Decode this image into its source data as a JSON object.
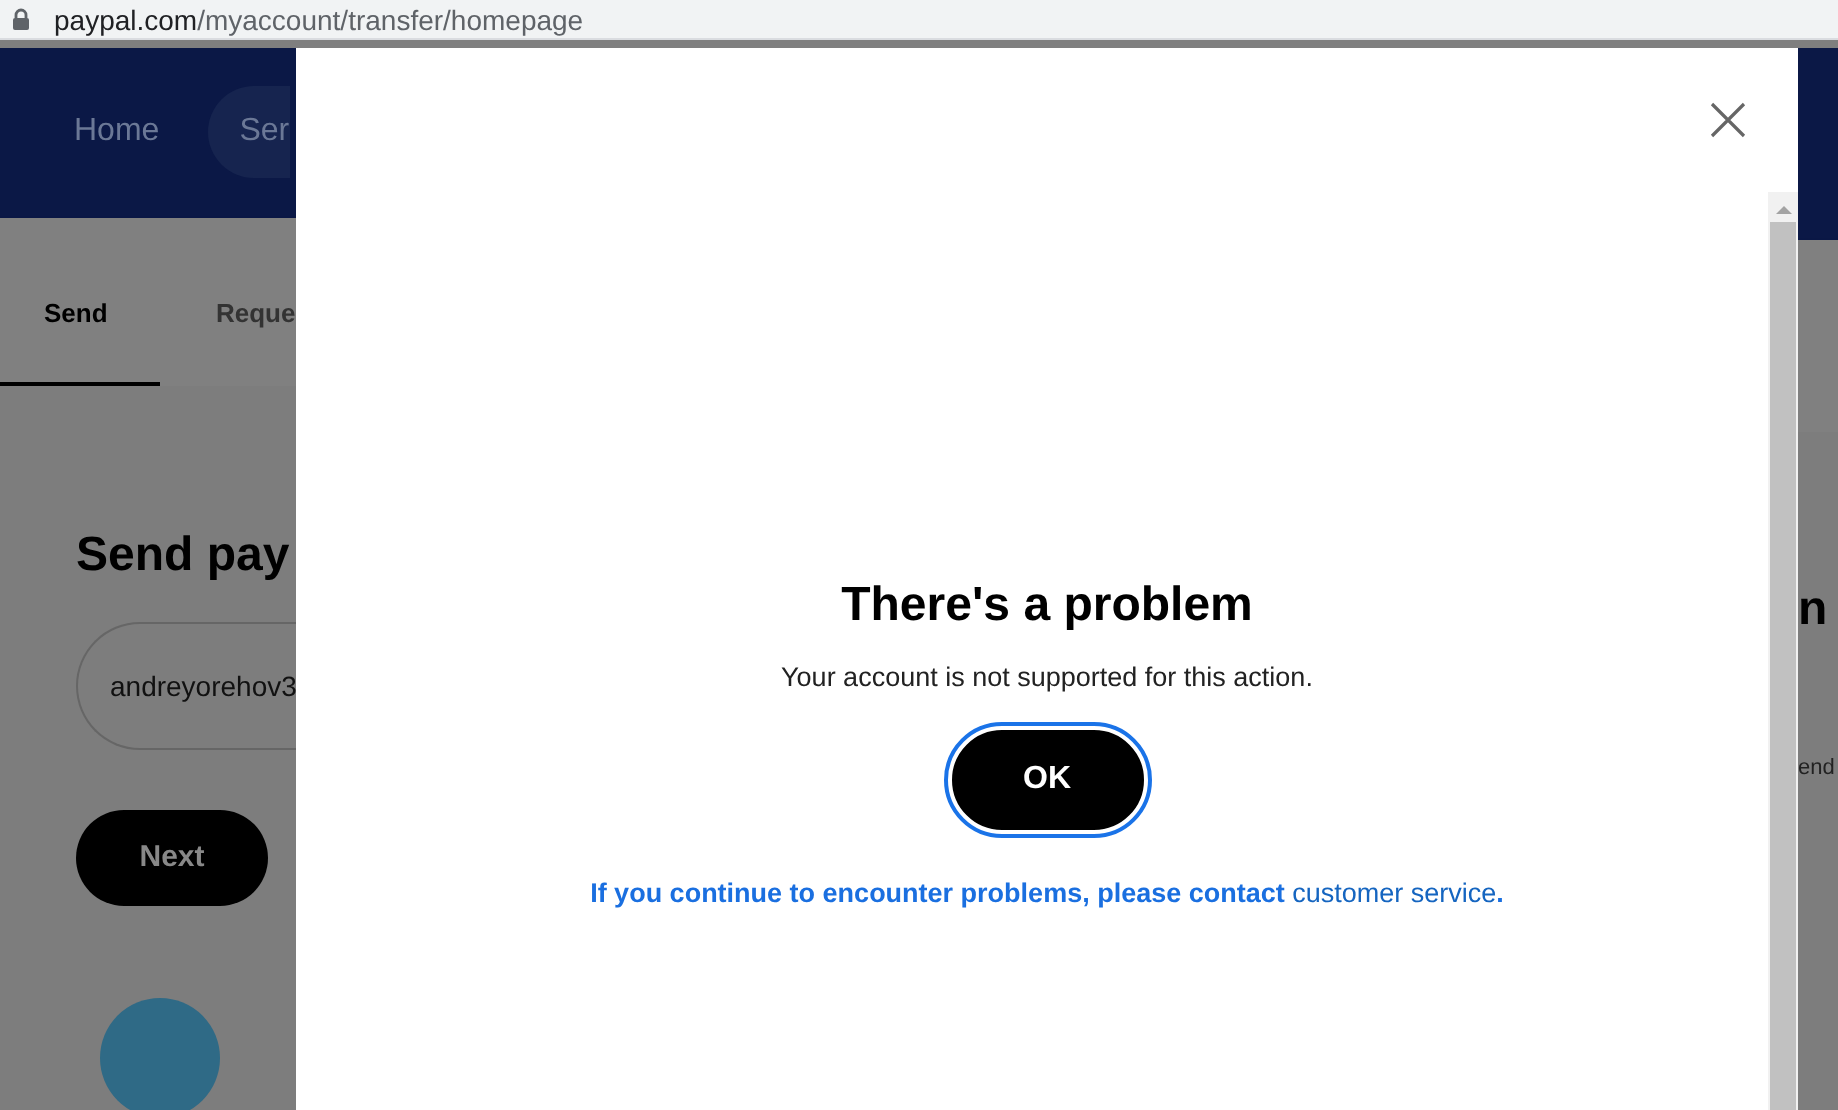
{
  "address_bar": {
    "url": "paypal.com/myaccount/transfer/homepage"
  },
  "background": {
    "nav": [
      {
        "label": "Home",
        "selected": false
      },
      {
        "label": "Ser",
        "selected": true
      }
    ],
    "tabs": [
      {
        "label": "Send",
        "selected": true
      },
      {
        "label": "Reque",
        "selected": false
      }
    ],
    "heading": "Send pay",
    "recipient_field": {
      "value": "andreyorehov3"
    },
    "next_button": "Next",
    "right_heading": "n",
    "right_text": "end"
  },
  "dialog": {
    "title": "There's a problem",
    "message": "Your account is not supported for this action.",
    "ok_button": "OK",
    "help_text": "If you continue to encounter problems, please contact",
    "help_link": "customer service",
    "help_end": "."
  }
}
